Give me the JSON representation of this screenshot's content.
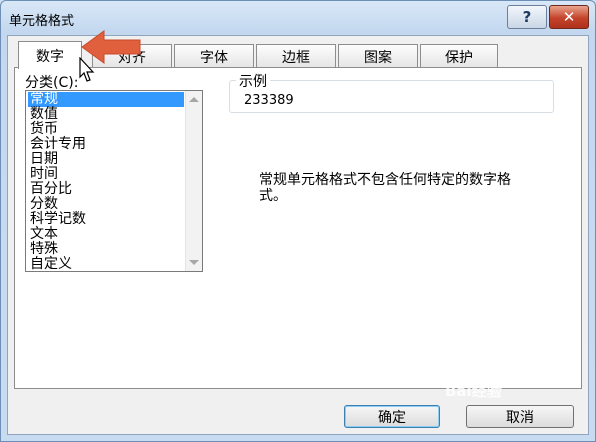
{
  "window": {
    "title": "单元格格式",
    "help_label": "?",
    "close_label": "✕"
  },
  "tabs": [
    {
      "label": "数字",
      "active": true
    },
    {
      "label": "对齐",
      "active": false
    },
    {
      "label": "字体",
      "active": false
    },
    {
      "label": "边框",
      "active": false
    },
    {
      "label": "图案",
      "active": false
    },
    {
      "label": "保护",
      "active": false
    }
  ],
  "category": {
    "label": "分类(C):",
    "items": [
      "常规",
      "数值",
      "货币",
      "会计专用",
      "日期",
      "时间",
      "百分比",
      "分数",
      "科学记数",
      "文本",
      "特殊",
      "自定义"
    ],
    "selected": "常规"
  },
  "sample": {
    "legend": "示例",
    "value": "233389"
  },
  "description": "常规单元格格式不包含任何特定的数字格式。",
  "buttons": {
    "ok": "确定",
    "cancel": "取消"
  },
  "watermark": "Bai经验",
  "colors": {
    "selection": "#3399ff",
    "annotation_arrow": "#e0603e"
  }
}
